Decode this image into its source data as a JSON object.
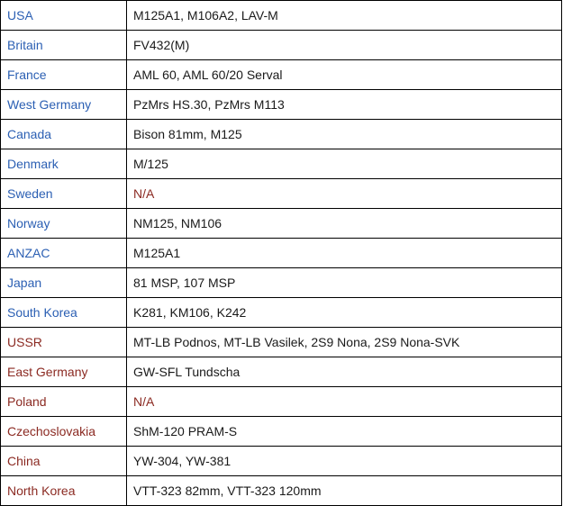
{
  "colors": {
    "nato_link": "#2b5fb3",
    "warsaw_link": "#8b2a22",
    "na_text": "#8b2a22",
    "body_text": "#1a1a1a",
    "border": "#000000"
  },
  "rows": [
    {
      "country": "USA",
      "vehicles": "M125A1, M106A2, LAV-M",
      "bloc": "blue",
      "na": false
    },
    {
      "country": "Britain",
      "vehicles": "FV432(M)",
      "bloc": "blue",
      "na": false
    },
    {
      "country": "France",
      "vehicles": "AML 60, AML 60/20 Serval",
      "bloc": "blue",
      "na": false
    },
    {
      "country": "West Germany",
      "vehicles": "PzMrs HS.30, PzMrs M113",
      "bloc": "blue",
      "na": false
    },
    {
      "country": "Canada",
      "vehicles": "Bison 81mm, M125",
      "bloc": "blue",
      "na": false
    },
    {
      "country": "Denmark",
      "vehicles": "M/125",
      "bloc": "blue",
      "na": false
    },
    {
      "country": "Sweden",
      "vehicles": "N/A",
      "bloc": "blue",
      "na": true
    },
    {
      "country": "Norway",
      "vehicles": "NM125, NM106",
      "bloc": "blue",
      "na": false
    },
    {
      "country": "ANZAC",
      "vehicles": "M125A1",
      "bloc": "blue",
      "na": false
    },
    {
      "country": "Japan",
      "vehicles": "81 MSP, 107 MSP",
      "bloc": "blue",
      "na": false
    },
    {
      "country": "South Korea",
      "vehicles": "K281, KM106, K242",
      "bloc": "blue",
      "na": false
    },
    {
      "country": "USSR",
      "vehicles": "MT-LB Podnos, MT-LB Vasilek, 2S9 Nona, 2S9 Nona-SVK",
      "bloc": "red",
      "na": false
    },
    {
      "country": "East Germany",
      "vehicles": "GW-SFL Tundscha",
      "bloc": "red",
      "na": false
    },
    {
      "country": "Poland",
      "vehicles": "N/A",
      "bloc": "red",
      "na": true
    },
    {
      "country": "Czechoslovakia",
      "vehicles": "ShM-120 PRAM-S",
      "bloc": "red",
      "na": false
    },
    {
      "country": "China",
      "vehicles": "YW-304, YW-381",
      "bloc": "red",
      "na": false
    },
    {
      "country": "North Korea",
      "vehicles": "VTT-323 82mm, VTT-323 120mm",
      "bloc": "red",
      "na": false
    }
  ]
}
